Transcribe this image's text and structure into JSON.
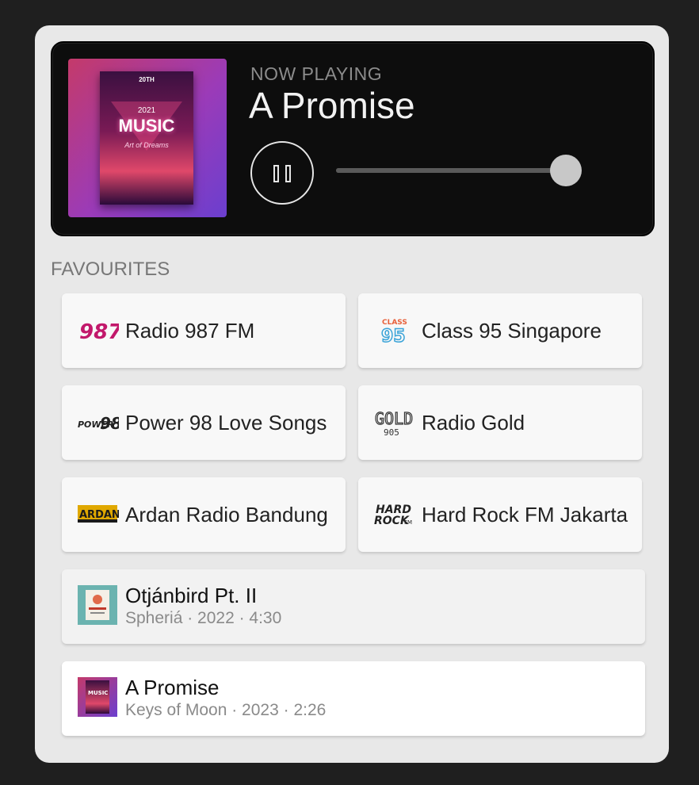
{
  "now_playing": {
    "label": "NOW PLAYING",
    "title": "A Promise",
    "progress_fraction": 1.0,
    "art": {
      "date": "20TH",
      "year": "2021",
      "word": "MUSIC",
      "script": "Art of Dreams"
    }
  },
  "favourites": {
    "label": "FAVOURITES",
    "stations": [
      {
        "name": "Radio 987 FM",
        "logo_text": "987",
        "logo_icon": "radio-987-logo",
        "logo_color": "#c2186b"
      },
      {
        "name": "Class 95 Singapore",
        "logo_text": "CLASS 95",
        "logo_icon": "class-95-logo",
        "logo_color": "#3aa3d8"
      },
      {
        "name": "Power 98 Love Songs",
        "logo_text": "POWER98",
        "logo_icon": "power-98-logo",
        "logo_color": "#222222"
      },
      {
        "name": "Radio Gold",
        "logo_text": "GOLD 905",
        "logo_icon": "gold-905-logo",
        "logo_color": "#333333"
      },
      {
        "name": "Ardan Radio Bandung",
        "logo_text": "ARDAN",
        "logo_icon": "ardan-logo",
        "logo_color": "#e0a800"
      },
      {
        "name": "Hard Rock FM Jakarta",
        "logo_text": "HARD ROCK FM",
        "logo_icon": "hard-rock-logo",
        "logo_color": "#222222"
      }
    ]
  },
  "tracks": [
    {
      "title": "Otjánbird Pt. II",
      "meta": "Spheriá · 2022 · 4:30",
      "thumb_icon": "world-music-day-art",
      "active": false
    },
    {
      "title": "A Promise",
      "meta": "Keys of Moon · 2023 · 2:26",
      "thumb_icon": "music-poster-art",
      "active": true
    }
  ]
}
